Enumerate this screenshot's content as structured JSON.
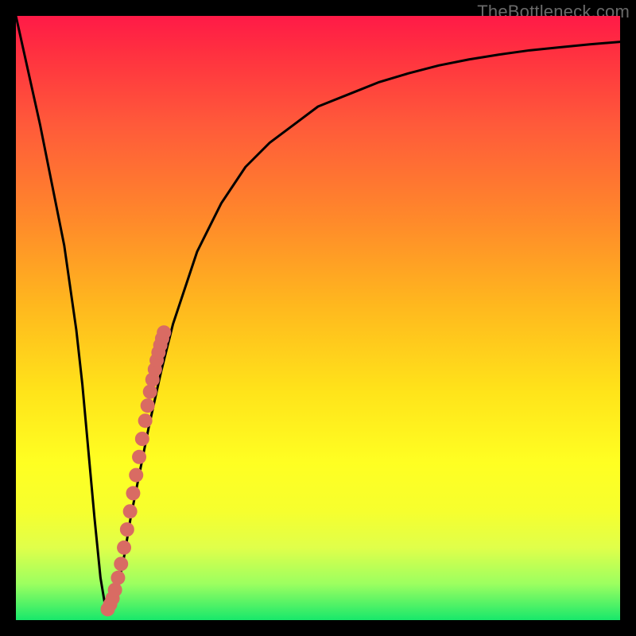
{
  "watermark": "TheBottleneck.com",
  "colors": {
    "frame": "#000000",
    "curve": "#000000",
    "dots": "#d96b63",
    "gradient_top": "#ff1a47",
    "gradient_bottom": "#18e86b"
  },
  "chart_data": {
    "type": "line",
    "title": "",
    "xlabel": "",
    "ylabel": "",
    "xlim": [
      0,
      100
    ],
    "ylim": [
      0,
      100
    ],
    "grid": false,
    "legend": false,
    "series": [
      {
        "name": "bottleneck-curve",
        "x": [
          0,
          2,
          4,
          6,
          8,
          10,
          11,
          12,
          13,
          14,
          15,
          16,
          17,
          18,
          19,
          20,
          22,
          24,
          26,
          28,
          30,
          34,
          38,
          42,
          46,
          50,
          55,
          60,
          65,
          70,
          75,
          80,
          85,
          90,
          95,
          100
        ],
        "y": [
          100,
          91,
          82,
          72,
          62,
          48,
          39,
          28,
          17,
          7,
          1,
          2,
          6,
          11,
          17,
          22,
          32,
          41,
          49,
          55,
          61,
          69,
          75,
          79,
          82,
          85,
          87,
          89,
          90.5,
          91.8,
          92.8,
          93.6,
          94.3,
          94.8,
          95.3,
          95.7
        ]
      }
    ],
    "highlight_points": {
      "name": "marked-range",
      "x": [
        15.2,
        15.6,
        16.0,
        16.4,
        16.9,
        17.4,
        17.9,
        18.4,
        18.9,
        19.4,
        19.9,
        20.4,
        20.9,
        21.4,
        21.8,
        22.2,
        22.6,
        23.0,
        23.3,
        23.6,
        23.9,
        24.2,
        24.5
      ],
      "y": [
        1.8,
        2.6,
        3.6,
        5.0,
        7.0,
        9.3,
        12.0,
        15.0,
        18.0,
        21.0,
        24.0,
        27.0,
        30.0,
        33.0,
        35.5,
        37.8,
        39.8,
        41.5,
        43.0,
        44.3,
        45.5,
        46.6,
        47.6
      ]
    }
  }
}
